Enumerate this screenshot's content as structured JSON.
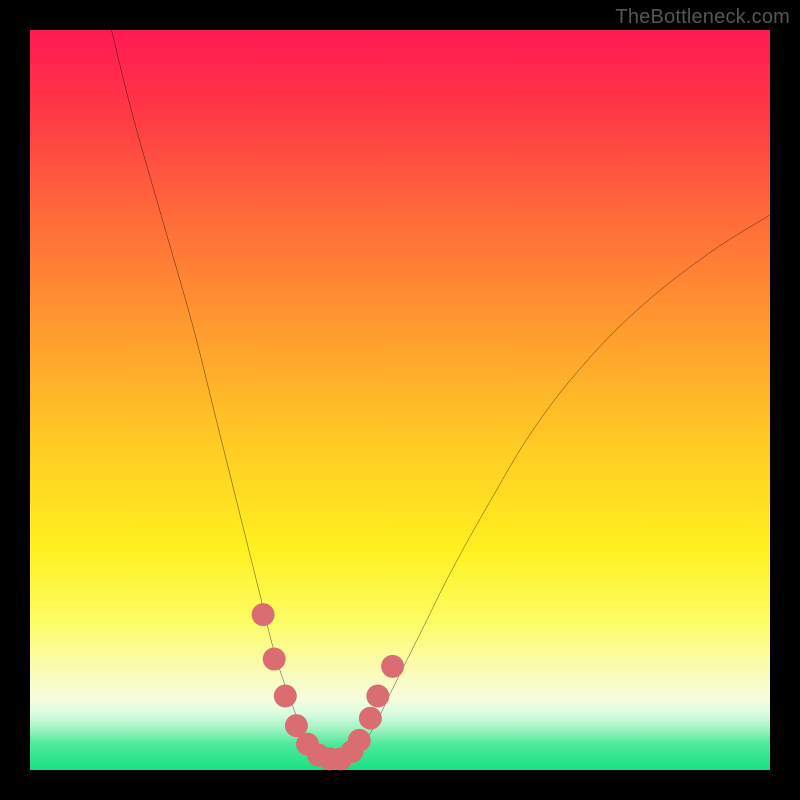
{
  "watermark": {
    "text": "TheBottleneck.com"
  },
  "colors": {
    "marker": "#d96d72",
    "curve": "#000000",
    "frame": "#000000",
    "gradient_stops": [
      {
        "pos": 0.0,
        "color": "#ff1a52"
      },
      {
        "pos": 0.1,
        "color": "#ff3547"
      },
      {
        "pos": 0.25,
        "color": "#ff6a3a"
      },
      {
        "pos": 0.4,
        "color": "#ff9a2f"
      },
      {
        "pos": 0.55,
        "color": "#ffc825"
      },
      {
        "pos": 0.7,
        "color": "#fff01f"
      },
      {
        "pos": 0.8,
        "color": "#fdfd66"
      },
      {
        "pos": 0.86,
        "color": "#fbfbb0"
      },
      {
        "pos": 0.905,
        "color": "#f6fde0"
      },
      {
        "pos": 0.925,
        "color": "#d8fbe0"
      },
      {
        "pos": 0.945,
        "color": "#9ff3c1"
      },
      {
        "pos": 0.965,
        "color": "#4fe99a"
      },
      {
        "pos": 1.0,
        "color": "#17e183"
      }
    ]
  },
  "chart_data": {
    "type": "line",
    "title": "",
    "xlabel": "",
    "ylabel": "",
    "xlim": [
      0,
      100
    ],
    "ylim": [
      0,
      100
    ],
    "grid": false,
    "series": [
      {
        "name": "bottleneck-curve",
        "x": [
          11,
          14,
          18,
          22,
          25,
          27,
          29,
          31,
          33,
          35,
          37,
          39,
          41,
          43,
          46,
          49,
          53,
          57,
          62,
          68,
          75,
          83,
          92,
          100
        ],
        "y": [
          100,
          88,
          74,
          60,
          48,
          40,
          32,
          24,
          16,
          10,
          5,
          2,
          1,
          2,
          5,
          11,
          19,
          27,
          36,
          46,
          55,
          63,
          70,
          75
        ]
      }
    ],
    "markers": {
      "name": "highlighted-points",
      "x": [
        31.5,
        33.0,
        34.5,
        36.0,
        37.5,
        39.0,
        40.5,
        42.0,
        43.5,
        44.5,
        46.0,
        47.0,
        49.0
      ],
      "y": [
        21.0,
        15.0,
        10.0,
        6.0,
        3.5,
        2.0,
        1.5,
        1.5,
        2.5,
        4.0,
        7.0,
        10.0,
        14.0
      ]
    }
  }
}
